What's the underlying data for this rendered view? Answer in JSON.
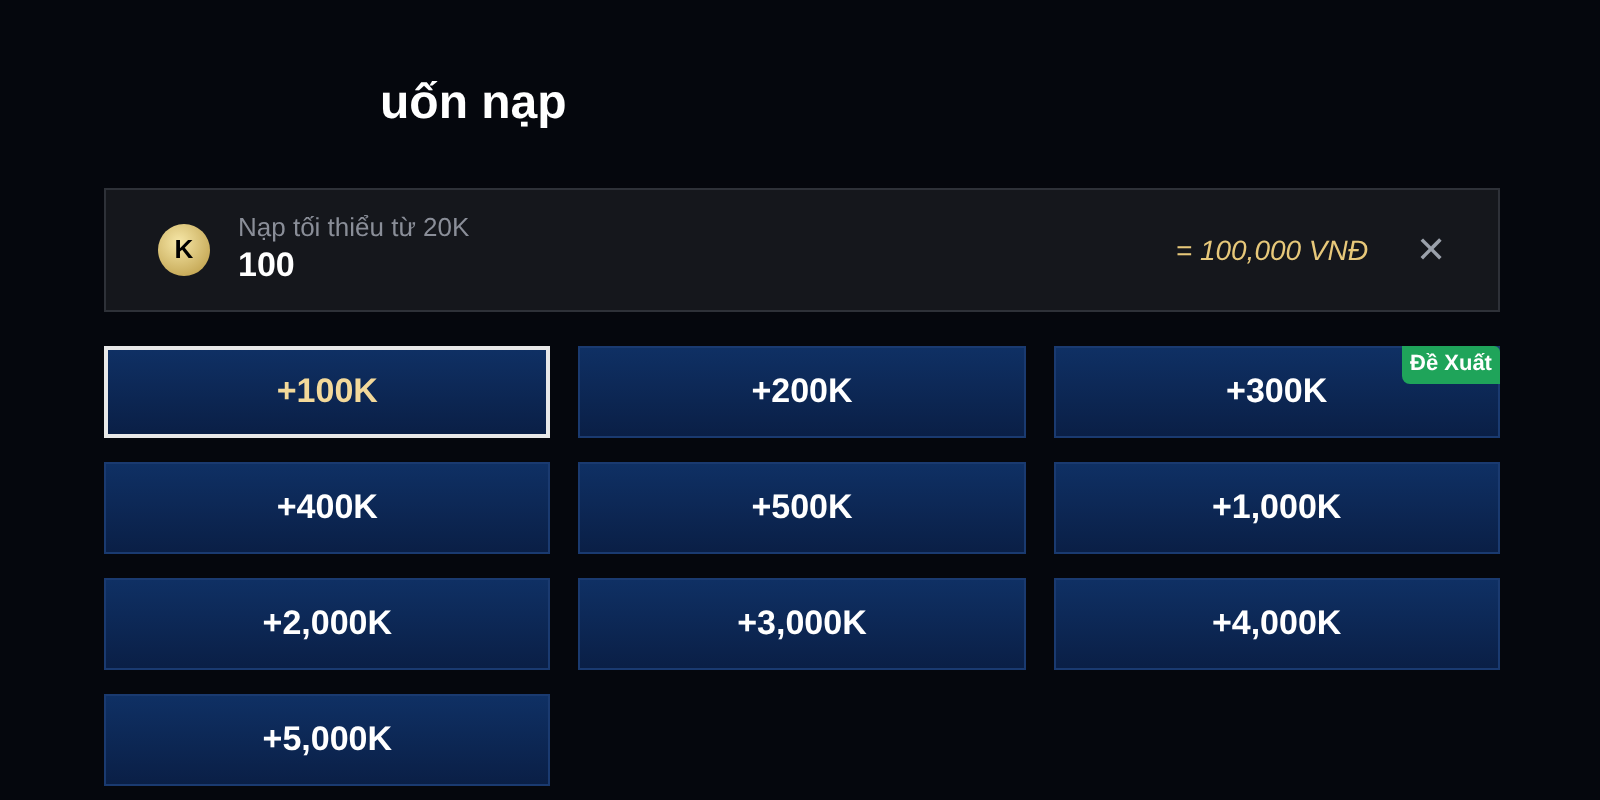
{
  "title": "uốn nạp",
  "amount_field": {
    "placeholder": "Nạp tối thiểu từ 20K",
    "value": "100",
    "coin_label": "K",
    "equivalent": "= 100,000 VNĐ",
    "clear": "✕"
  },
  "options": [
    {
      "label": "+100K",
      "selected": true
    },
    {
      "label": "+200K",
      "selected": false
    },
    {
      "label": "+300K",
      "selected": false,
      "badge": "Đề Xuất"
    },
    {
      "label": "+400K",
      "selected": false
    },
    {
      "label": "+500K",
      "selected": false
    },
    {
      "label": "+1,000K",
      "selected": false
    },
    {
      "label": "+2,000K",
      "selected": false
    },
    {
      "label": "+3,000K",
      "selected": false
    },
    {
      "label": "+4,000K",
      "selected": false
    },
    {
      "label": "+5,000K",
      "selected": false
    }
  ]
}
